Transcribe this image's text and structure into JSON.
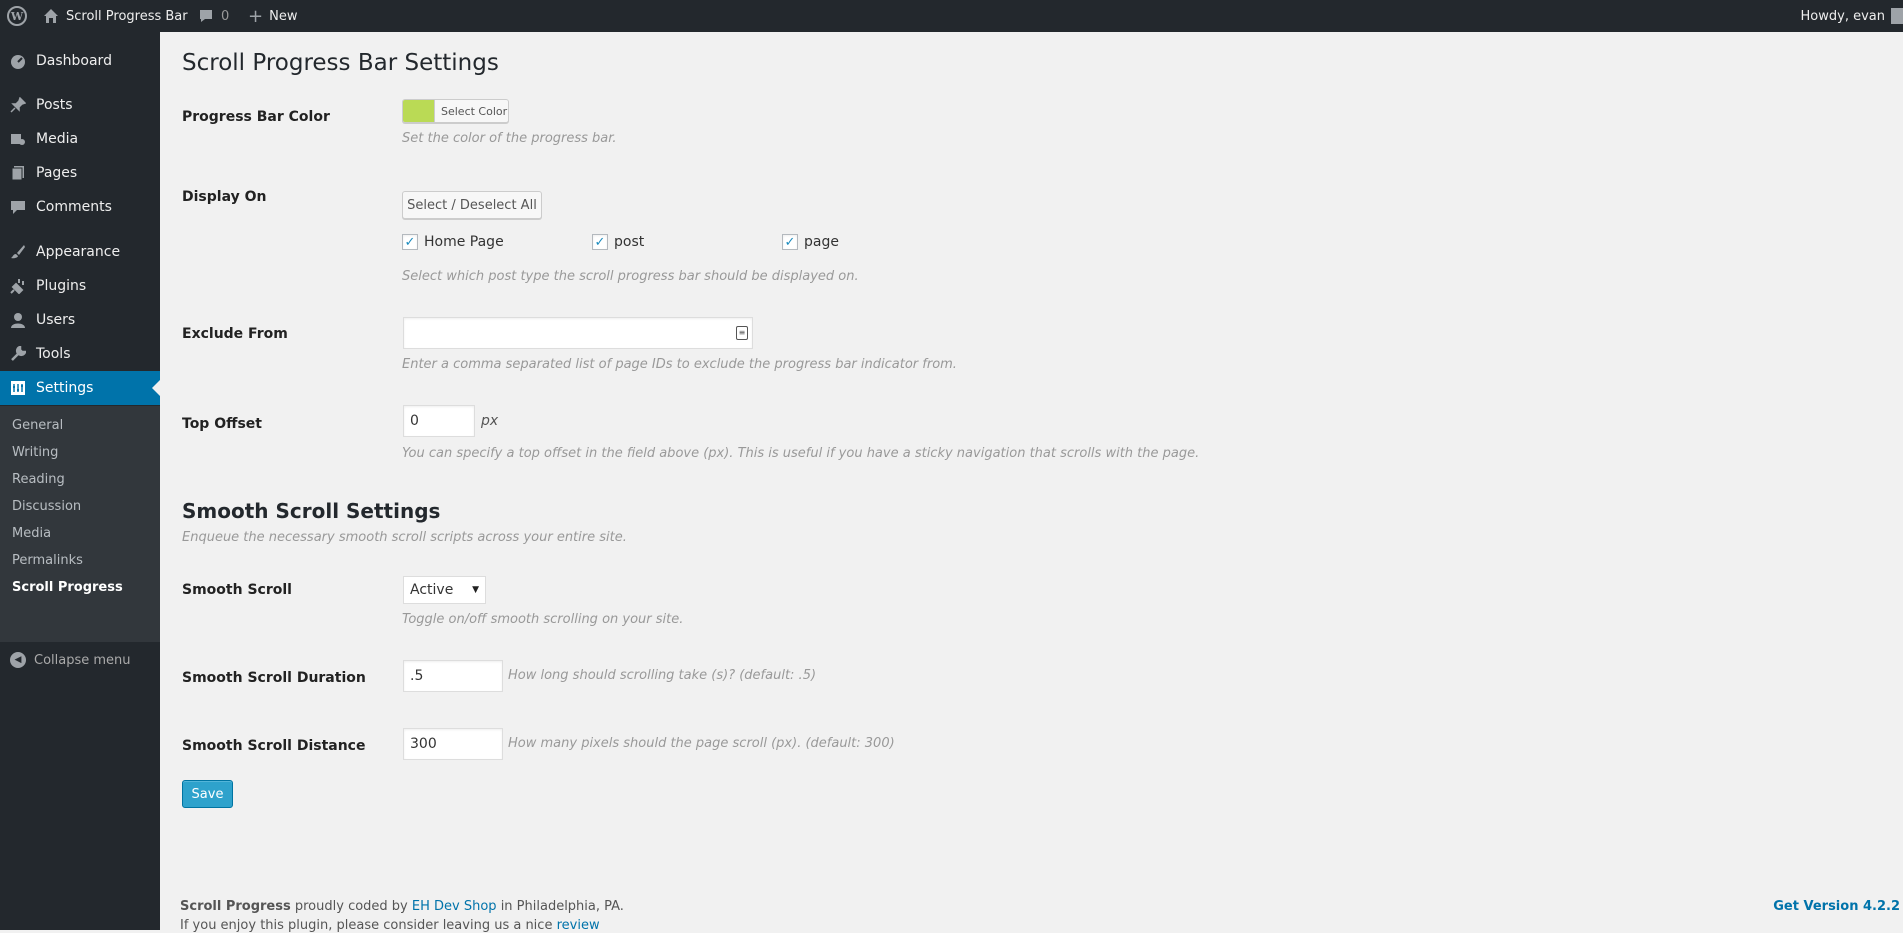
{
  "admin_bar": {
    "site_name": "Scroll Progress Bar",
    "comments_count": "0",
    "new_label": "New",
    "greeting": "Howdy, evan"
  },
  "sidebar": {
    "items": [
      {
        "label": "Dashboard",
        "icon": "dashboard-icon"
      },
      {
        "label": "Posts",
        "icon": "pin-icon"
      },
      {
        "label": "Media",
        "icon": "media-icon"
      },
      {
        "label": "Pages",
        "icon": "pages-icon"
      },
      {
        "label": "Comments",
        "icon": "comment-icon"
      },
      {
        "label": "Appearance",
        "icon": "brush-icon"
      },
      {
        "label": "Plugins",
        "icon": "plug-icon"
      },
      {
        "label": "Users",
        "icon": "user-icon"
      },
      {
        "label": "Tools",
        "icon": "wrench-icon"
      },
      {
        "label": "Settings",
        "icon": "settings-icon"
      }
    ],
    "submenu": [
      "General",
      "Writing",
      "Reading",
      "Discussion",
      "Media",
      "Permalinks",
      "Scroll Progress"
    ],
    "collapse_label": "Collapse menu"
  },
  "page": {
    "title": "Scroll Progress Bar Settings",
    "progress_bar_color": {
      "label": "Progress Bar Color",
      "button": "Select Color",
      "color": "#bada55",
      "desc": "Set the color of the progress bar."
    },
    "display_on": {
      "label": "Display On",
      "button": "Select / Deselect All",
      "options": [
        {
          "label": "Home Page",
          "checked": true
        },
        {
          "label": "post",
          "checked": true
        },
        {
          "label": "page",
          "checked": true
        }
      ],
      "desc": "Select which post type the scroll progress bar should be displayed on."
    },
    "exclude_from": {
      "label": "Exclude From",
      "value": "",
      "desc": "Enter a comma separated list of page IDs to exclude the progress bar indicator from."
    },
    "top_offset": {
      "label": "Top Offset",
      "value": "0",
      "unit": "px",
      "desc": "You can specify a top offset in the field above (px). This is useful if you have a sticky navigation that scrolls with the page."
    },
    "smooth_section": {
      "title": "Smooth Scroll Settings",
      "desc": "Enqueue the necessary smooth scroll scripts across your entire site."
    },
    "smooth_scroll": {
      "label": "Smooth Scroll",
      "value": "Active",
      "desc": "Toggle on/off smooth scrolling on your site."
    },
    "smooth_duration": {
      "label": "Smooth Scroll Duration",
      "value": ".5",
      "desc": "How long should scrolling take (s)? (default: .5)"
    },
    "smooth_distance": {
      "label": "Smooth Scroll Distance",
      "value": "300",
      "desc": "How many pixels should the page scroll (px). (default: 300)"
    },
    "save_label": "Save"
  },
  "footer": {
    "plugin_name": "Scroll Progress",
    "text1": "proudly coded by",
    "author_link": "EH Dev Shop",
    "text2": "in Philadelphia, PA.",
    "line2": "If you enjoy this plugin, please consider leaving us a nice",
    "review_link": "review",
    "version_link": "Get Version 4.2.2"
  },
  "colors": {
    "admin_bar": "#23282d",
    "accent": "#0073aa",
    "save_button": "#2ea2cc"
  }
}
